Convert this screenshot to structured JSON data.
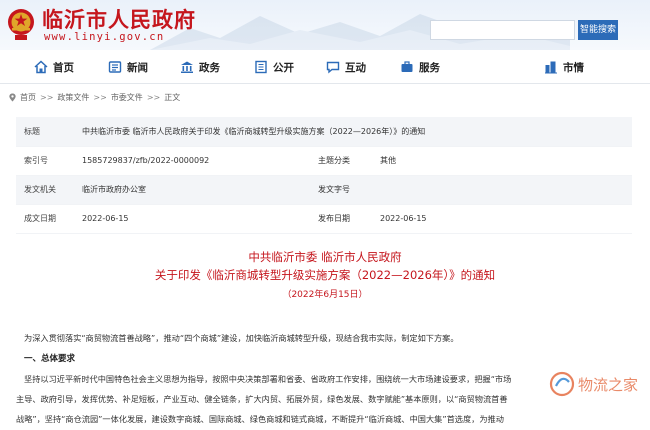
{
  "header": {
    "site_title": "临沂市人民政府",
    "site_url": "www.linyi.gov.cn",
    "search_placeholder": "",
    "search_button": "智能搜索"
  },
  "nav": [
    {
      "label": "首页",
      "icon": "home-icon"
    },
    {
      "label": "新闻",
      "icon": "news-icon"
    },
    {
      "label": "政务",
      "icon": "government-icon"
    },
    {
      "label": "公开",
      "icon": "disclosure-icon"
    },
    {
      "label": "互动",
      "icon": "interaction-icon"
    },
    {
      "label": "服务",
      "icon": "service-icon"
    },
    {
      "label": "市情",
      "icon": "city-info-icon"
    }
  ],
  "breadcrumb": [
    "首页",
    "政策文件",
    "市委文件",
    "正文"
  ],
  "meta": {
    "title_label": "标题",
    "title_value": "中共临沂市委 临沂市人民政府关于印发《临沂商城转型升级实施方案（2022—2026年）》的通知",
    "index_label": "索引号",
    "index_value": "1585729837/zfb/2022-0000092",
    "topic_label": "主题分类",
    "topic_value": "其他",
    "issuer_label": "发文机关",
    "issuer_value": "临沂市政府办公室",
    "docno_label": "发文字号",
    "docno_value": "",
    "created_label": "成文日期",
    "created_value": "2022-06-15",
    "published_label": "发布日期",
    "published_value": "2022-06-15"
  },
  "article": {
    "title_line1": "中共临沂市委  临沂市人民政府",
    "title_line2": "关于印发《临沂商城转型升级实施方案（2022—2026年）》的通知",
    "date": "（2022年6月15日）",
    "intro": "为深入贯彻落实“商贸物流首善战略”，推动“四个商城”建设，加快临沂商城转型升级，现结合我市实际，制定如下方案。",
    "section1": "一、总体要求",
    "p1_line1": "坚持以习近平新时代中国特色社会主义思想为指导，按照中央决策部署和省委、省政府工作安排，围绕统一大市场建设要求，把握“市场",
    "p1_line2": "主导、政府引导，发挥优势、补足短板，产业互动、健全链条，扩大内贸、拓展外贸，绿色发展、数字赋能”基本原则，以“商贸物流首善",
    "p1_line3": "战略”，坚持“商仓流园”一体化发展，建设数字商城、国际商城、绿色商城和链式商城，不断提升“临沂商城、中国大集”首选度，为推动"
  },
  "watermark": "物流之家",
  "colors": {
    "brand_red": "#c5161d",
    "nav_blue": "#2c6bb8"
  }
}
